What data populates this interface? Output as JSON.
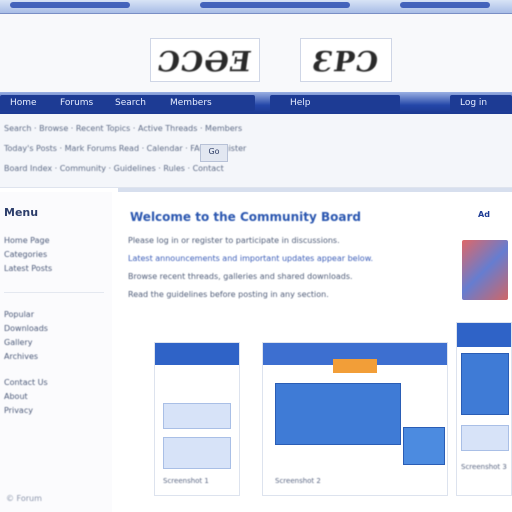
{
  "header": {
    "captcha_left": "ƆƆƏƎ",
    "captcha_right": "ƐPƆ"
  },
  "navbar": {
    "items": [
      "Home",
      "Forums",
      "Search",
      "Members",
      "Help",
      "Log in"
    ]
  },
  "subbar": {
    "rows": [
      "Search · Browse · Recent Topics · Active Threads · Members",
      "Today's Posts · Mark Forums Read · Calendar · FAQ · Register",
      "Board Index · Community · Guidelines · Rules · Contact"
    ],
    "button_label": "Go"
  },
  "sidebar": {
    "title": "Menu",
    "links": [
      "Home Page",
      "Categories",
      "Latest Posts",
      "Popular",
      "Downloads",
      "Gallery",
      "Archives",
      "Contact Us",
      "About",
      "Privacy"
    ]
  },
  "main": {
    "title": "Welcome to the Community Board",
    "lines": [
      "Please log in or register to participate in discussions.",
      "Latest announcements and important updates appear below.",
      "Browse recent threads, galleries and shared downloads.",
      "Read the guidelines before posting in any section."
    ],
    "ad_label": "Ad"
  },
  "thumbnails": [
    {
      "label": "Screenshot 1"
    },
    {
      "label": "Screenshot 2"
    },
    {
      "label": "Screenshot 3"
    }
  ],
  "footer": {
    "mark": "© Forum"
  }
}
